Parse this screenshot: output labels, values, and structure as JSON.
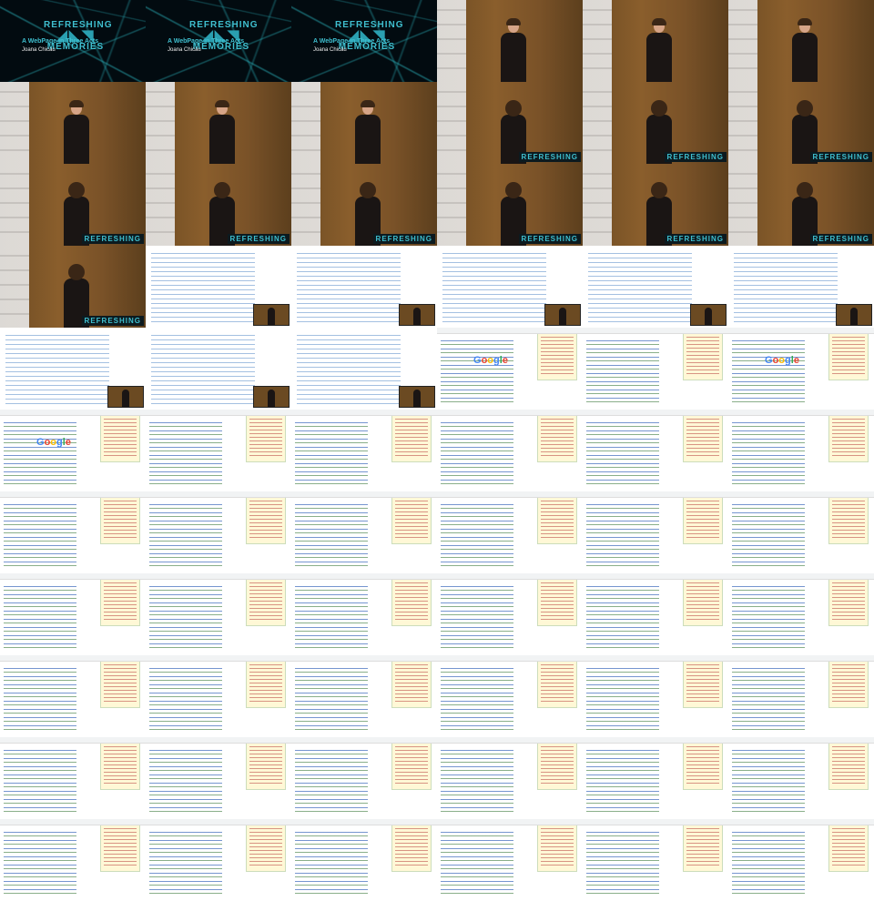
{
  "title_card": {
    "logo_line1": "REFRESHING",
    "logo_mark": "◢◣◥",
    "logo_line2": "MEMORIES",
    "subtitle": "A WebPage in Three Acts",
    "author": "Joana Chicau"
  },
  "stage_banner": "REFRESHING",
  "google_logo_letters": [
    "G",
    "o",
    "o",
    "g",
    "l",
    "e"
  ],
  "frames": [
    "title",
    "title",
    "title",
    "stage-m",
    "stage-m",
    "stage-m",
    "stage-m",
    "stage-m",
    "stage-m",
    "stage-f",
    "stage-f",
    "stage-f",
    "stage-f",
    "stage-f",
    "stage-f",
    "stage-f",
    "stage-f",
    "stage-f",
    "stage-f",
    "code",
    "code",
    "code",
    "code",
    "code",
    "code",
    "code",
    "code",
    "google",
    "browser",
    "google",
    "google",
    "browser",
    "browser",
    "browser",
    "browser",
    "browser",
    "browser",
    "browser",
    "browser",
    "browser",
    "browser",
    "browser",
    "browser",
    "browser",
    "browser",
    "browser",
    "browser",
    "browser",
    "browser",
    "browser",
    "browser",
    "browser",
    "browser",
    "browser",
    "browser",
    "browser",
    "browser",
    "browser",
    "browser",
    "browser",
    "browser",
    "browser",
    "browser",
    "browser",
    "browser",
    "browser"
  ]
}
